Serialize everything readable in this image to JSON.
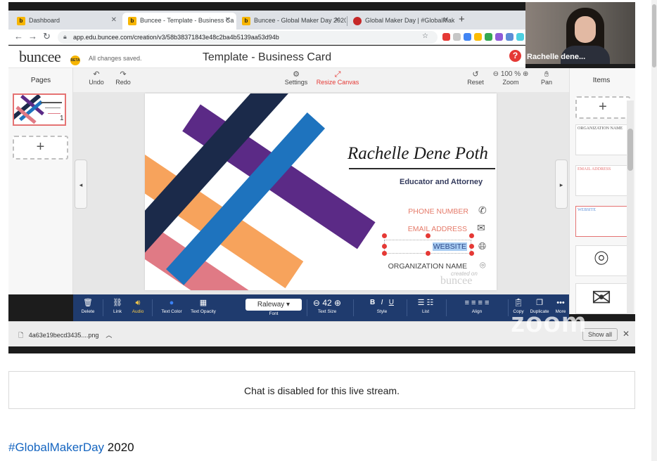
{
  "browser": {
    "tabs": [
      {
        "title": "Dashboard",
        "active": false
      },
      {
        "title": "Buncee - Template - Business Ca",
        "active": true
      },
      {
        "title": "Buncee - Global Maker Day 2020",
        "active": false
      },
      {
        "title": "Global Maker Day | #GlobalMake",
        "active": false
      }
    ],
    "new_tab": "+",
    "url": "app.edu.buncee.com/creation/v3/58b38371843e48c2ba4b5139aa53d94b"
  },
  "app": {
    "logo": "buncee",
    "beta_badge": "BETA",
    "save_status": "All changes saved.",
    "document_title": "Template - Business Card",
    "help": "?"
  },
  "toolbar": {
    "undo": "Undo",
    "redo": "Redo",
    "settings": "Settings",
    "resize_canvas": "Resize Canvas",
    "reset": "Reset",
    "zoom_value": "100 %",
    "zoom": "Zoom",
    "pan": "Pan"
  },
  "pages_panel": {
    "title": "Pages",
    "page_number": "1",
    "add": "+"
  },
  "items_panel": {
    "title": "Items",
    "add": "+",
    "items": [
      {
        "label": "ORGANIZATION NAME",
        "color": "#555555"
      },
      {
        "label": "EMAIL ADDRESS",
        "color": "#e57373"
      },
      {
        "label": "WEBSITE",
        "color": "#5c8dd6"
      }
    ]
  },
  "card": {
    "name": "Rachelle Dene Poth",
    "role": "Educator and Attorney",
    "phone": "PHONE NUMBER",
    "email": "EMAIL ADDRESS",
    "website": "WEBSITE",
    "organization": "ORGANIZATION NAME",
    "watermark_small": "created on",
    "watermark_brand": "buncee",
    "stripe_colors": {
      "navy": "#1b2a4a",
      "purple": "#5b2a86",
      "orange": "#f7a35c",
      "blue": "#1e73be",
      "pink": "#e07a85"
    }
  },
  "format_bar": {
    "delete": "Delete",
    "link": "Link",
    "audio": "Audio",
    "text_color": "Text Color",
    "text_opacity": "Text Opacity",
    "font_value": "Raleway",
    "font": "Font",
    "size_value": "42",
    "text_size": "Text Size",
    "bold": "B",
    "italic": "I",
    "underline": "U",
    "style": "Style",
    "list": "List",
    "align": "Align",
    "copy": "Copy",
    "duplicate": "Duplicate",
    "more": "More"
  },
  "download_bar": {
    "file": "4a63e19becd3435....png",
    "show_all": "Show all",
    "close": "✕"
  },
  "video_overlay": {
    "participant_name": "Rachelle dene...",
    "zoom_watermark": "zoom"
  },
  "page": {
    "chat_status": "Chat is disabled for this live stream.",
    "hashtag": "#GlobalMakerDay",
    "year": "2020"
  },
  "colors": {
    "accent_red": "#e53935",
    "format_bar": "#1f3b6e",
    "link_blue": "#1565c0"
  }
}
